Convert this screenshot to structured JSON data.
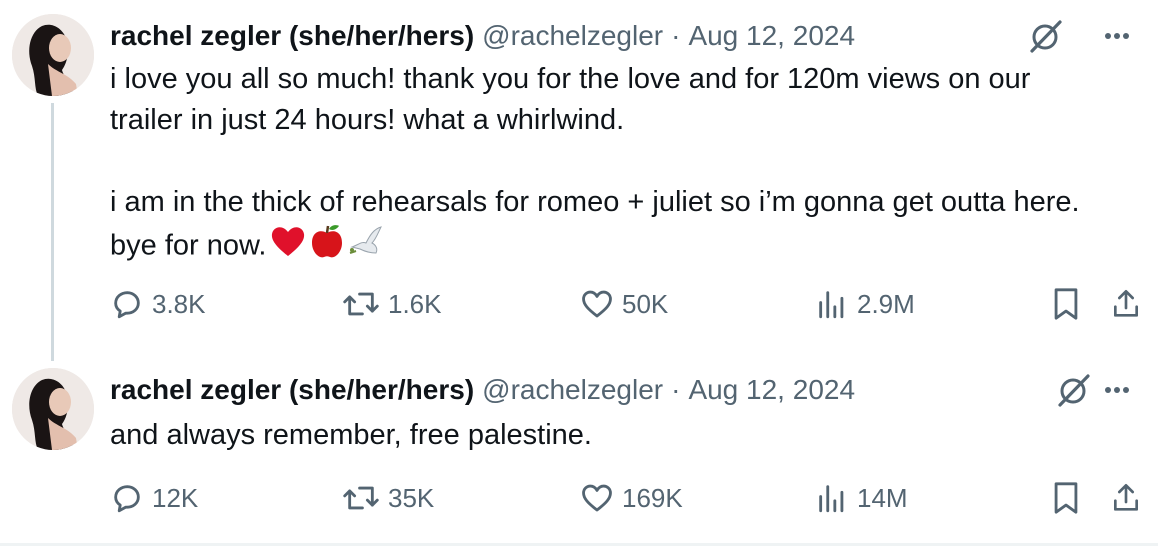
{
  "tweets": [
    {
      "author_name": "rachel zegler (she/her/hers)",
      "handle": "@rachelzegler",
      "separator": "·",
      "date": "Aug 12, 2024",
      "text": "i love you all so much! thank you for the love and for 120m views on our\ntrailer in just 24 hours! what a whirlwind.\n\ni am in the thick of rehearsals for romeo + juliet so i’m gonna get outta here.\nbye for now.",
      "emojis": [
        "heart-icon",
        "apple-icon",
        "dove-icon"
      ],
      "stats": {
        "replies": "3.8K",
        "reposts": "1.6K",
        "likes": "50K",
        "views": "2.9M"
      }
    },
    {
      "author_name": "rachel zegler (she/her/hers)",
      "handle": "@rachelzegler",
      "separator": "·",
      "date": "Aug 12, 2024",
      "text": "and always remember, free palestine.",
      "stats": {
        "replies": "12K",
        "reposts": "35K",
        "likes": "169K",
        "views": "14M"
      }
    }
  ],
  "colors": {
    "text": "#0f1419",
    "secondary": "#536471",
    "thread_line": "#cfd9de"
  }
}
